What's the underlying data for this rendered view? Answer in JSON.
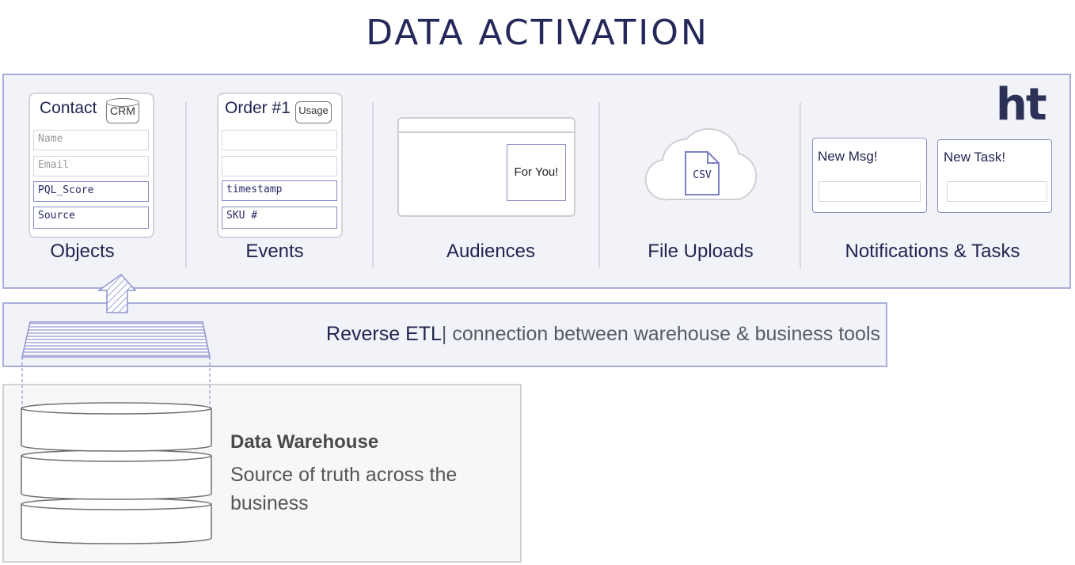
{
  "title": "DATA ACTIVATION",
  "logo": "ht",
  "categories": {
    "objects": {
      "label": "Objects",
      "card_title": "Contact",
      "tag": "CRM",
      "fields": [
        "Name",
        "Email",
        "PQL_Score",
        "Source"
      ],
      "active_fields": [
        false,
        false,
        true,
        true
      ]
    },
    "events": {
      "label": "Events",
      "card_title": "Order #1",
      "tag": "Usage",
      "fields": [
        "",
        "",
        "timestamp",
        "SKU #"
      ],
      "active_fields": [
        false,
        false,
        true,
        true
      ]
    },
    "audiences": {
      "label": "Audiences",
      "banner": "For You!"
    },
    "file_uploads": {
      "label": "File Uploads",
      "file_type": "CSV"
    },
    "notifications": {
      "label": "Notifications & Tasks",
      "msg_title": "New Msg!",
      "task_title": "New Task!"
    }
  },
  "reverse_etl": {
    "label": "Reverse ETL",
    "separator": "|",
    "description": "connection between warehouse & business tools"
  },
  "warehouse": {
    "title": "Data Warehouse",
    "description": "Source of truth across the business"
  },
  "colors": {
    "navy": "#24285a",
    "accent_border": "#a9addb",
    "panel_bg": "#f2f3f8"
  }
}
